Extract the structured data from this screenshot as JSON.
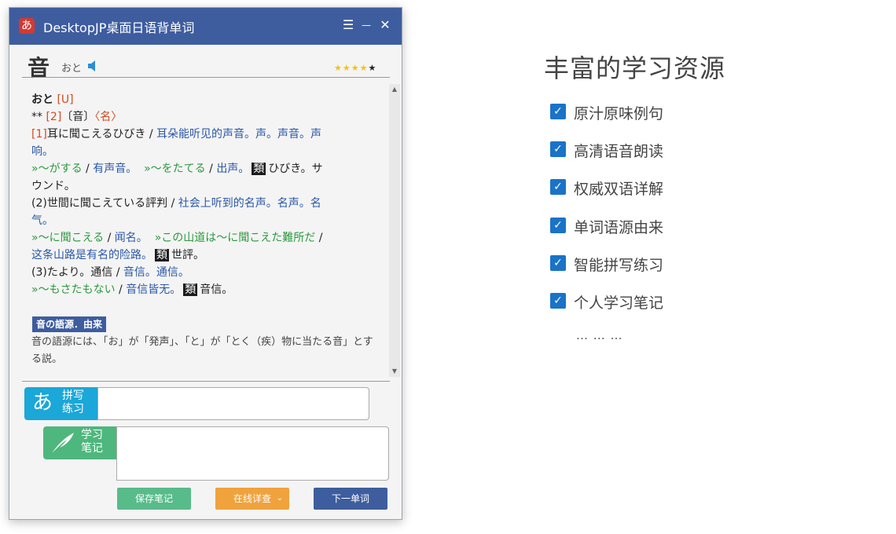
{
  "window": {
    "app_title": "DesktopJP桌面日语背单词",
    "logo_char": "あ",
    "menu_glyph": "☰",
    "minimize_glyph": "—",
    "close_glyph": "✕"
  },
  "entry": {
    "word": "音",
    "reading": "おと",
    "rating": 4,
    "rating_max": 5,
    "stars_on": "★★★★",
    "stars_off": "★",
    "line1": {
      "head": "おと",
      "tag": "[U]"
    },
    "line2": {
      "stars": "**",
      "num": "[2]",
      "kanji": "〔音〕",
      "pos": "〈名〉"
    },
    "sense1": {
      "num": "[1]",
      "jp": "耳に聞こえるひびき",
      "sep": " / ",
      "cn": "耳朵能听见的声音。声。声音。声",
      "cn_cont": "响。"
    },
    "ex1": {
      "a": "»～がする",
      "a_cn": "有声音。",
      "b": "»～をたてる",
      "b_cn": "出声。",
      "rui": "類",
      "rui_text": "ひびき。サ",
      "rui_cont": "ウンド。"
    },
    "sense2": {
      "jp": "(2)世間に聞こえている評判",
      "cn": "社会上听到的名声。名声。名",
      "cn_cont": "气。"
    },
    "ex2": {
      "a": "»～に聞こえる",
      "a_cn": "闻名。",
      "b": "»この山道は～に聞こえた難所だ",
      "b_cn": "这条山路是有名的险路。",
      "rui": "類",
      "rui_text": "世評。"
    },
    "sense3": {
      "jp": "(3)たより。通信",
      "cn": "音信。通信。"
    },
    "ex3": {
      "a": "»～もさたもない",
      "a_cn": "音信皆无。",
      "rui": "類",
      "rui_text": "音信。"
    },
    "origin_label": "音の語源．由来",
    "origin_text": "音の語源には、「お」が「発声」、「と」が「とく（疾）物に当たる音」とする説。"
  },
  "scroll": {
    "up": "▲",
    "down": "▼"
  },
  "spell": {
    "kana": "あ",
    "label_line1": "拼写",
    "label_line2": "练习",
    "value": ""
  },
  "notes": {
    "icon": "quill-icon",
    "label_line1": "学习",
    "label_line2": "笔记",
    "value": ""
  },
  "buttons": {
    "save": "保存笔记",
    "online": "在线详查",
    "online_chevron": "⌄",
    "next": "下一单词"
  },
  "promo": {
    "title": "丰富的学习资源",
    "features": [
      {
        "label": "原汁原味例句",
        "checked": true
      },
      {
        "label": "高清语音朗读",
        "checked": true
      },
      {
        "label": "权威双语详解",
        "checked": true
      },
      {
        "label": "单词语源由来",
        "checked": true
      },
      {
        "label": "智能拼写练习",
        "checked": true
      },
      {
        "label": "个人学习笔记",
        "checked": true
      }
    ],
    "more": "… … …",
    "check_glyph": "✓"
  },
  "colors": {
    "title_bar": "#3e5d9f",
    "spell": "#1ba7d8",
    "notes": "#4eb77d",
    "save": "#58bb8a",
    "online": "#f0a23c",
    "next": "#3e5d9f",
    "check": "#1a73c8"
  }
}
